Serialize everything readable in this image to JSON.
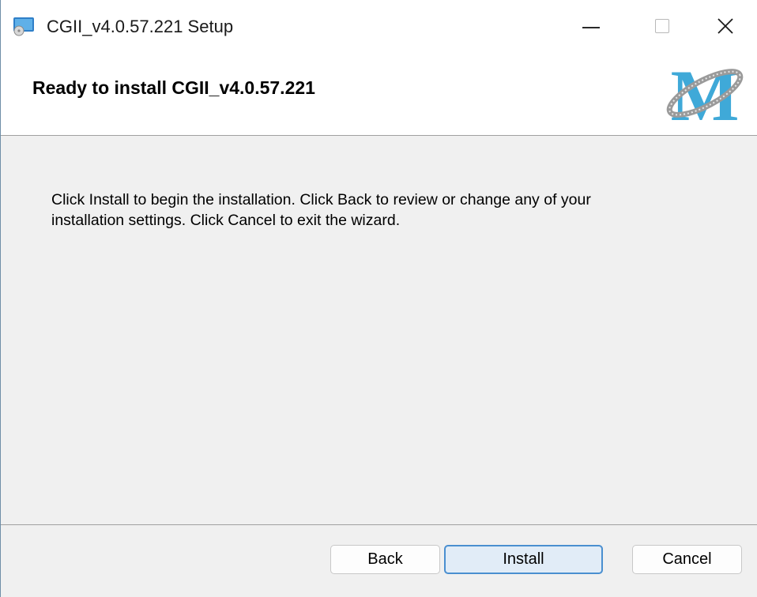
{
  "window": {
    "title": "CGII_v4.0.57.221 Setup"
  },
  "banner": {
    "title": "Ready to install CGII_v4.0.57.221",
    "logo_text": "M"
  },
  "body": {
    "lines": [
      "Click Install to begin the installation. Click Back to review or change any of your",
      "installation settings. Click Cancel to exit the wizard."
    ]
  },
  "buttons": {
    "back": "Back",
    "install": "Install",
    "cancel": "Cancel"
  },
  "colors": {
    "accent_border": "#4a8fd0",
    "install_fill": "#e1ecf7",
    "logo_blue": "#3fa9d8"
  },
  "icons": {
    "app": "installer-disc-icon",
    "minimize": "minimize-icon",
    "maximize": "maximize-icon",
    "close": "close-icon"
  }
}
